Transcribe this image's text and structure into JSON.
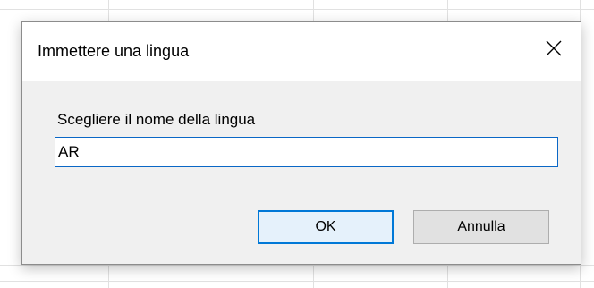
{
  "dialog": {
    "title": "Immettere una lingua",
    "close_icon": "close-icon",
    "prompt_label": "Scegliere il nome della lingua",
    "language_value": "AR",
    "ok_label": "OK",
    "cancel_label": "Annulla"
  },
  "colors": {
    "dialog_bg": "#f0f0f0",
    "titlebar_bg": "#ffffff",
    "accent": "#0078d7",
    "grid": "#e1e1e1"
  }
}
